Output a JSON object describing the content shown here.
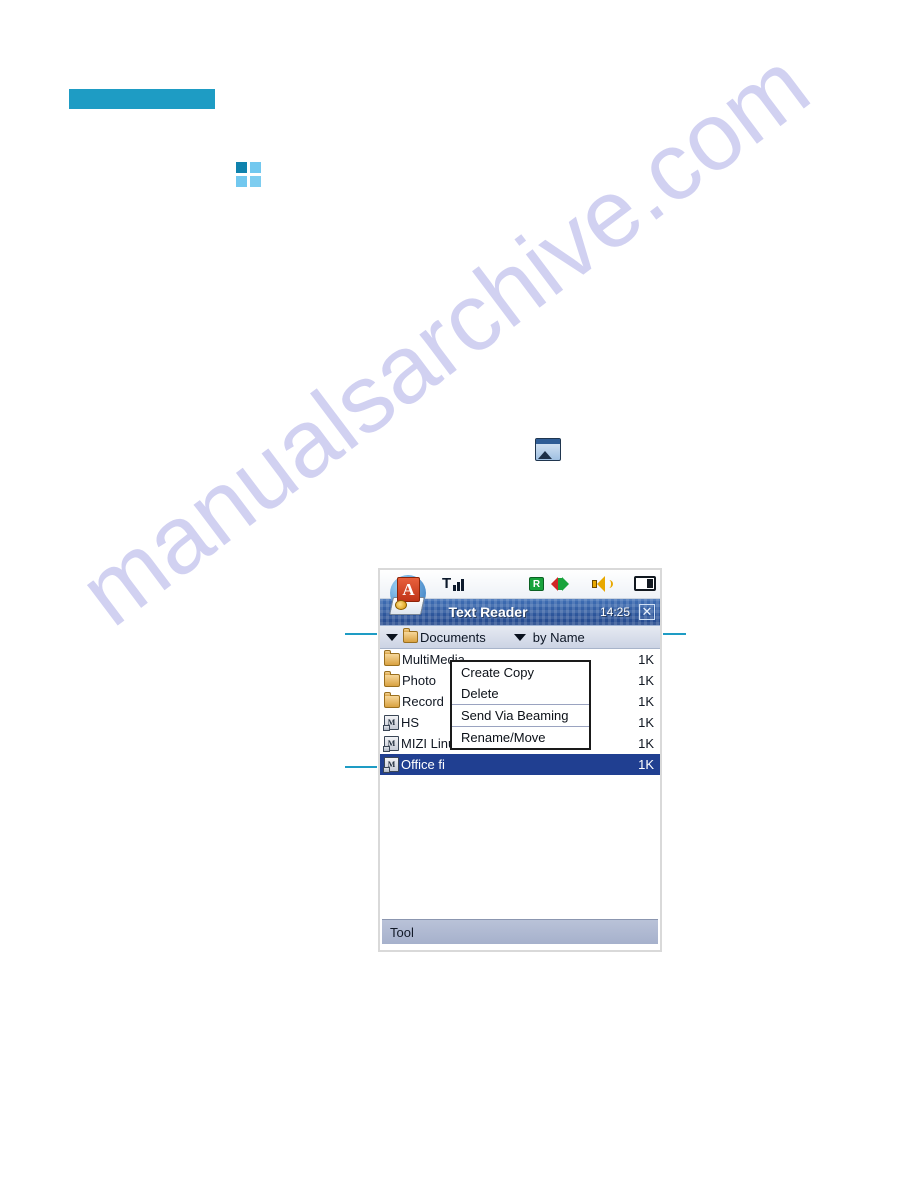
{
  "page": {
    "watermark": "manualsarchive.com",
    "teal_bar": "",
    "grid_icon_name": "grid-squares-icon",
    "photo_icon_name": "image-window-icon",
    "accent_color": "#1e9cc4"
  },
  "device": {
    "status_bar": {
      "signal_label": "T",
      "roaming_badge": "R",
      "sync_icon_name": "sync-arrows-icon",
      "speaker_icon_name": "speaker-icon",
      "battery_icon_name": "battery-icon"
    },
    "title_bar": {
      "app_icon_letter": "A",
      "title": "Text Reader",
      "time": "14:25",
      "close_label": "✕"
    },
    "path_bar": {
      "folder_label": "Documents",
      "sort_label": "by Name"
    },
    "file_list": [
      {
        "name": "MultiMedia",
        "size": "1K",
        "type": "folder",
        "selected": false
      },
      {
        "name": "Photo",
        "size": "1K",
        "type": "folder",
        "selected": false
      },
      {
        "name": "Record",
        "size": "1K",
        "type": "folder",
        "selected": false
      },
      {
        "name": "HS",
        "size": "1K",
        "type": "doc",
        "selected": false
      },
      {
        "name": "MIZI Linux",
        "size": "1K",
        "type": "doc",
        "selected": false
      },
      {
        "name": "Office fi",
        "size": "1K",
        "type": "doc",
        "selected": true
      }
    ],
    "context_menu": [
      {
        "label": "Create Copy",
        "separator_above": false
      },
      {
        "label": "Delete",
        "separator_above": false
      },
      {
        "label": "Send Via Beaming",
        "separator_above": true
      },
      {
        "label": "Rename/Move",
        "separator_above": true
      }
    ],
    "tool_bar": {
      "label": "Tool"
    }
  }
}
